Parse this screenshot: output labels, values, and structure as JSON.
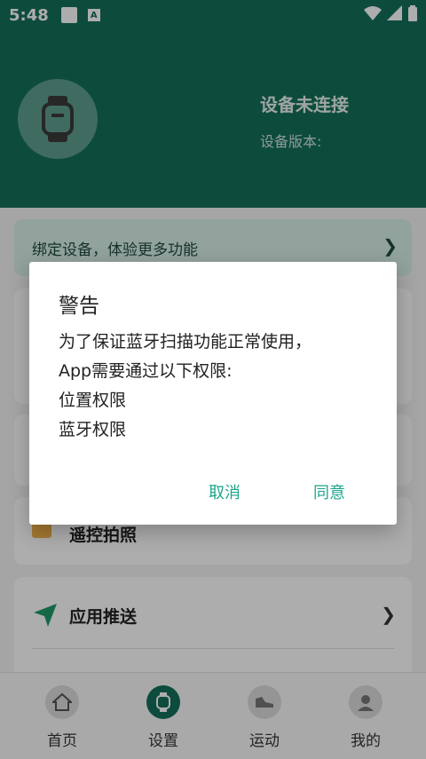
{
  "status_bar": {
    "time": "5:48"
  },
  "header": {
    "device_status": "设备未连接",
    "device_version_label": "设备版本:"
  },
  "bind_banner": {
    "text": "绑定设备，体验更多功能"
  },
  "menu": {
    "remote_photo": "遥控拍照",
    "app_push": "应用推送"
  },
  "bottom_nav": {
    "items": [
      {
        "label": "首页",
        "icon": "home-icon"
      },
      {
        "label": "设置",
        "icon": "watch-icon"
      },
      {
        "label": "运动",
        "icon": "shoe-icon"
      },
      {
        "label": "我的",
        "icon": "profile-icon"
      }
    ]
  },
  "dialog": {
    "title": "警告",
    "lines": [
      "为了保证蓝牙扫描功能正常使用，",
      "App需要通过以下权限:",
      "位置权限",
      "蓝牙权限"
    ],
    "cancel": "取消",
    "agree": "同意"
  },
  "colors": {
    "primary": "#14705a",
    "accent": "#1ea58b"
  }
}
